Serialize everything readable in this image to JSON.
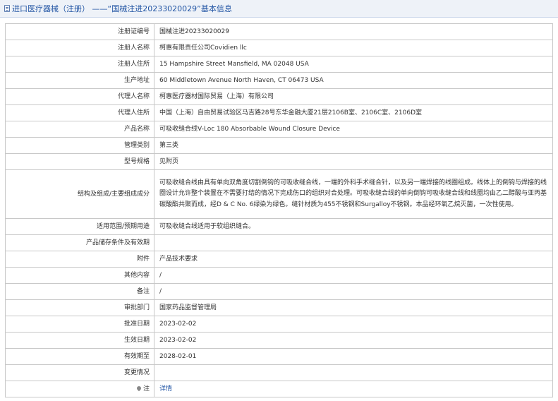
{
  "header": {
    "title": "进口医疗器械（注册） ——“国械注进20233020029”基本信息"
  },
  "rows": [
    {
      "label": "注册证编号",
      "value": "国械注进20233020029"
    },
    {
      "label": "注册人名称",
      "value": "柯惠有限责任公司Covidien llc"
    },
    {
      "label": "注册人住所",
      "value": "15 Hampshire Street Mansfield, MA 02048 USA"
    },
    {
      "label": "生产地址",
      "value": "60 Middletown Avenue North Haven, CT 06473 USA"
    },
    {
      "label": "代理人名称",
      "value": "柯惠医疗器材国际贸易（上海）有限公司"
    },
    {
      "label": "代理人住所",
      "value": "中国（上海）自由贸易试验区马吉路28号东华金融大厦21层2106B室、2106C室、2106D室"
    },
    {
      "label": "产品名称",
      "value": "可吸收缝合线V-Loc 180 Absorbable Wound Closure Device"
    },
    {
      "label": "管理类别",
      "value": "第三类"
    },
    {
      "label": "型号规格",
      "value": "见附页"
    },
    {
      "label": "结构及组成/主要组成成分",
      "value": "可吸收缝合线由具有单向双角度切割倒钩的可吸收缝合线，一端的外科手术缝合针，以及另一端焊接的线圈组成。线体上的倒钩与焊接的线圈设计允许整个装置在不需要打结的情况下完成伤口的组织对合处理。可吸收缝合线的单向倒钩可吸收缝合线和线圈均由乙二醇酸与亚丙基碳酸酯共聚而成，经D & C No. 6绿染为绿色。缝针材质为455不锈钢和Surgalloy不锈钢。本品经环氧乙烷灭菌，一次性使用。"
    },
    {
      "label": "适用范围/预期用途",
      "value": "可吸收缝合线适用于软组织缝合。"
    },
    {
      "label": "产品储存条件及有效期",
      "value": ""
    },
    {
      "label": "附件",
      "value": "产品技术要求"
    },
    {
      "label": "其他内容",
      "value": "/"
    },
    {
      "label": "备注",
      "value": "/"
    },
    {
      "label": "审批部门",
      "value": "国家药品监督管理局"
    },
    {
      "label": "批准日期",
      "value": "2023-02-02"
    },
    {
      "label": "生效日期",
      "value": "2023-02-02"
    },
    {
      "label": "有效期至",
      "value": "2028-02-01"
    },
    {
      "label": "变更情况",
      "value": ""
    }
  ],
  "note_row": {
    "label": "注",
    "link": "详情"
  }
}
